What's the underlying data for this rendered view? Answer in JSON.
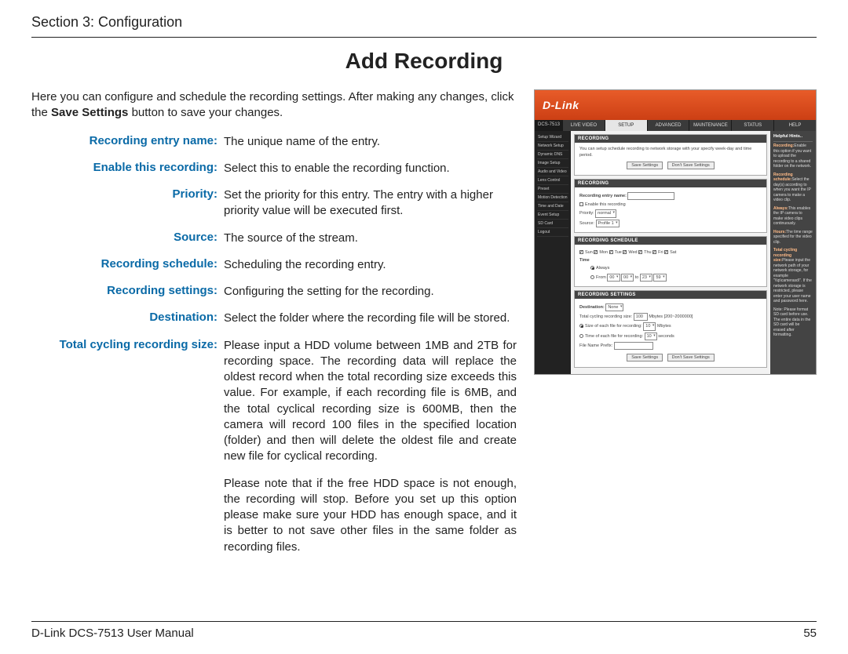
{
  "header": {
    "section": "Section 3: Configuration"
  },
  "title": "Add Recording",
  "intro": {
    "before_bold": "Here you can configure and schedule the recording settings. After making any changes, click the ",
    "bold": "Save Settings",
    "after_bold": " button to save your changes."
  },
  "defs": [
    {
      "term": "Recording entry name:",
      "desc": "The unique name of the entry."
    },
    {
      "term": "Enable this recording:",
      "desc": "Select this to enable the recording function."
    },
    {
      "term": "Priority:",
      "desc": "Set the priority for this entry. The entry with a higher priority value will be executed first."
    },
    {
      "term": "Source:",
      "desc": "The source of the stream."
    },
    {
      "term": "Recording schedule:",
      "desc": "Scheduling the recording entry."
    },
    {
      "term": "Recording settings:",
      "desc": "Configuring the setting for the recording."
    },
    {
      "term": "Destination:",
      "desc": "Select the folder where the recording file will be stored."
    }
  ],
  "tcrs": {
    "term": "Total cycling recording size:",
    "p1": "Please input a HDD volume between 1MB and 2TB for recording space. The recording data will replace the oldest record when the total recording size exceeds this value. For example, if each recording file is 6MB, and the total cyclical recording size is 600MB, then the camera will record 100 files in the specified location (folder) and then will delete the oldest file and create new file for cyclical recording.",
    "p2": "Please note that if the free HDD space is not enough, the recording will stop. Before you set up this option please make sure your HDD has enough space, and it is better to not save other files in the same folder as recording files."
  },
  "shot": {
    "logo": "D-Link",
    "model": "DCS-7513",
    "tabs": [
      "LIVE VIDEO",
      "SETUP",
      "ADVANCED",
      "MAINTENANCE",
      "STATUS",
      "HELP"
    ],
    "active_tab": 1,
    "side": [
      "Setup Wizard",
      "Network Setup",
      "Dynamic DNS",
      "Image Setup",
      "Audio and Video",
      "Lens Control",
      "Preset",
      "Motion Detection",
      "Time and Date",
      "Event Setup",
      "SD Card",
      "Logout"
    ],
    "p_recording": {
      "h": "RECORDING",
      "text": "You can setup schedule recording to network storage with your specify week-day and time period.",
      "save": "Save Settings",
      "dont": "Don't Save Settings"
    },
    "p_entry": {
      "h": "RECORDING",
      "l_name": "Recording entry name:",
      "l_enable": "Enable this recording",
      "l_priority": "Priority:",
      "v_priority": "normal",
      "l_source": "Source:",
      "v_source": "Profile 1"
    },
    "p_sched": {
      "h": "RECORDING SCHEDULE",
      "days": [
        "Sun",
        "Mon",
        "Tue",
        "Wed",
        "Thu",
        "Fri",
        "Sat"
      ],
      "l_time": "Time",
      "l_always": "Always",
      "l_from": "From",
      "v_fh": "00",
      "v_fm": "00",
      "v_th": "23",
      "v_tm": "59",
      "l_to": "to"
    },
    "p_settings": {
      "h": "RECORDING SETTINGS",
      "l_dest": "Destination:",
      "v_dest": "None",
      "l_tcrs": "Total cycling recording size:",
      "v_tcrs": "100",
      "u_tcrs": "Mbytes [200~2000000]",
      "l_size": "Size of each file for recording:",
      "v_size": "10",
      "u_size": "Mbytes",
      "l_time": "Time of each file for recording:",
      "v_time": "10",
      "u_time": "seconds",
      "l_prefix": "File Name Prefix:",
      "save": "Save Settings",
      "dont": "Don't Save Settings"
    },
    "help": {
      "h": "Helpful Hints..",
      "p1b": "Recording:",
      "p1": "Enable this option if you want to upload the recording to a shared folder on the network.",
      "p2b": "Recording schedule:",
      "p2": "Select the day(s) according to when you want the IP camera to make a video clip.",
      "p3b": "Always:",
      "p3": "This enables the IP camera to make video clips continuously.",
      "p4b": "Hours:",
      "p4": "The time range specified for the video clip.",
      "p5b": "Total cycling recording size:",
      "p5": "Please input the network path of your network storage, for example \"\\\\ip\\camerasd\\\". If the network storage is restricted, please enter your user name and password here.",
      "p6": "Note: Please format SD card before use. The entire data in the SD card will be erased after formatting."
    }
  },
  "footer": {
    "left": "D-Link DCS-7513 User Manual",
    "right": "55"
  }
}
